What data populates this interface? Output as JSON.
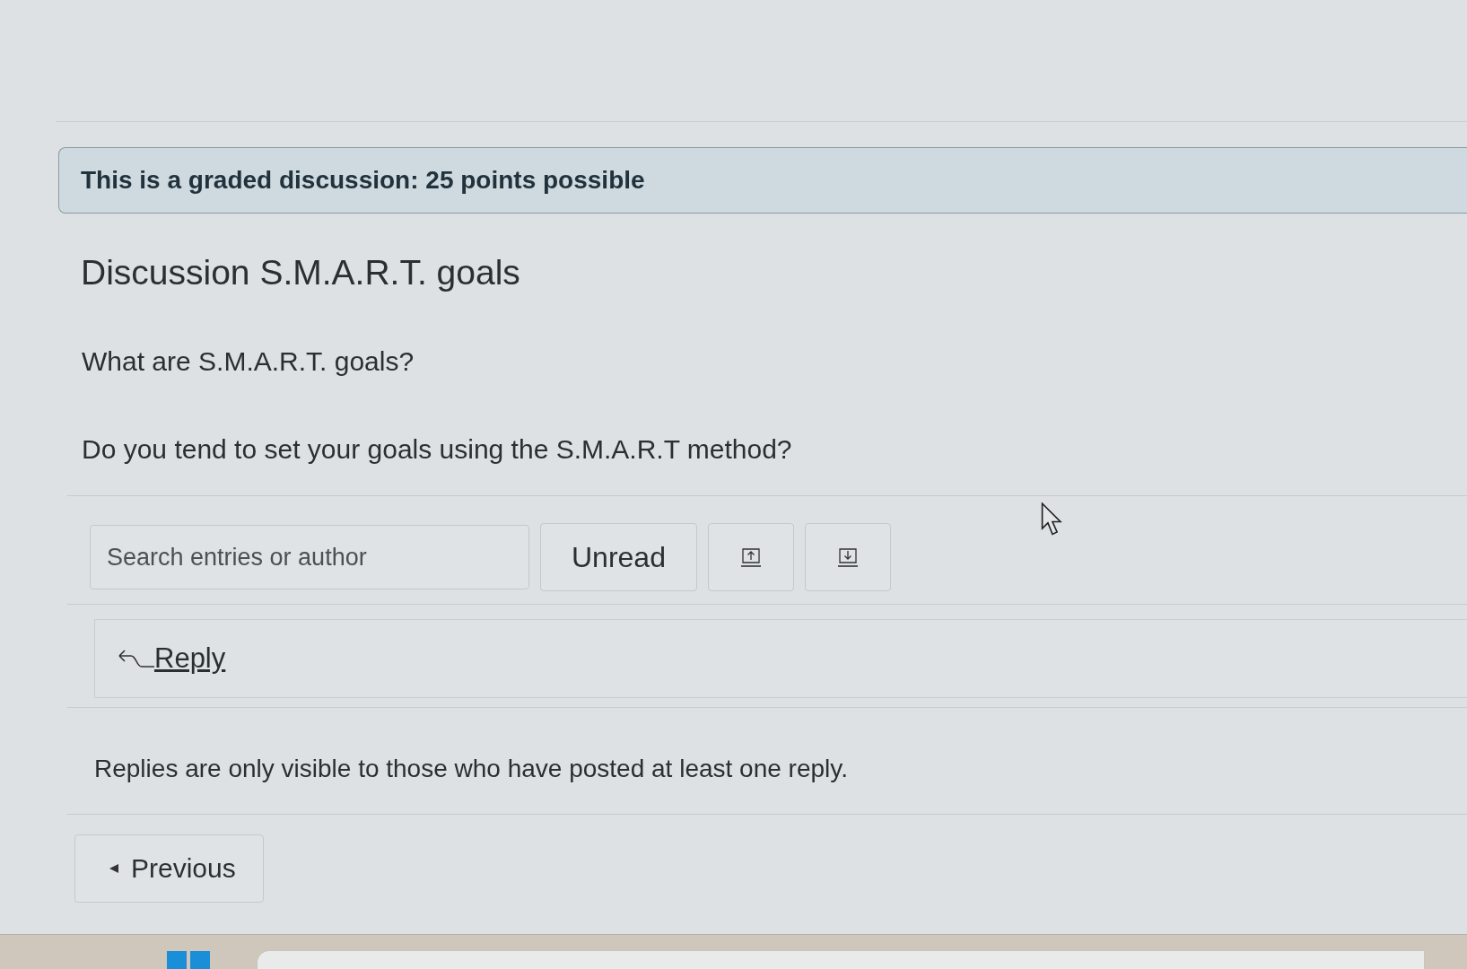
{
  "banner": {
    "text": "This is a graded discussion: 25 points possible"
  },
  "discussion": {
    "title": "Discussion S.M.A.R.T. goals",
    "paragraphs": [
      "What are S.M.A.R.T. goals?",
      "Do you tend to set your goals using the S.M.A.R.T method?"
    ]
  },
  "toolbar": {
    "search": {
      "placeholder": "Search entries or author"
    },
    "filter_button": "Unread",
    "sort_buttons": [
      {
        "kind": "up"
      },
      {
        "kind": "down"
      }
    ]
  },
  "reply_button": "Reply",
  "notice": "Replies are only visible to those who have posted at least one reply.",
  "pager": {
    "previous": "Previous"
  }
}
